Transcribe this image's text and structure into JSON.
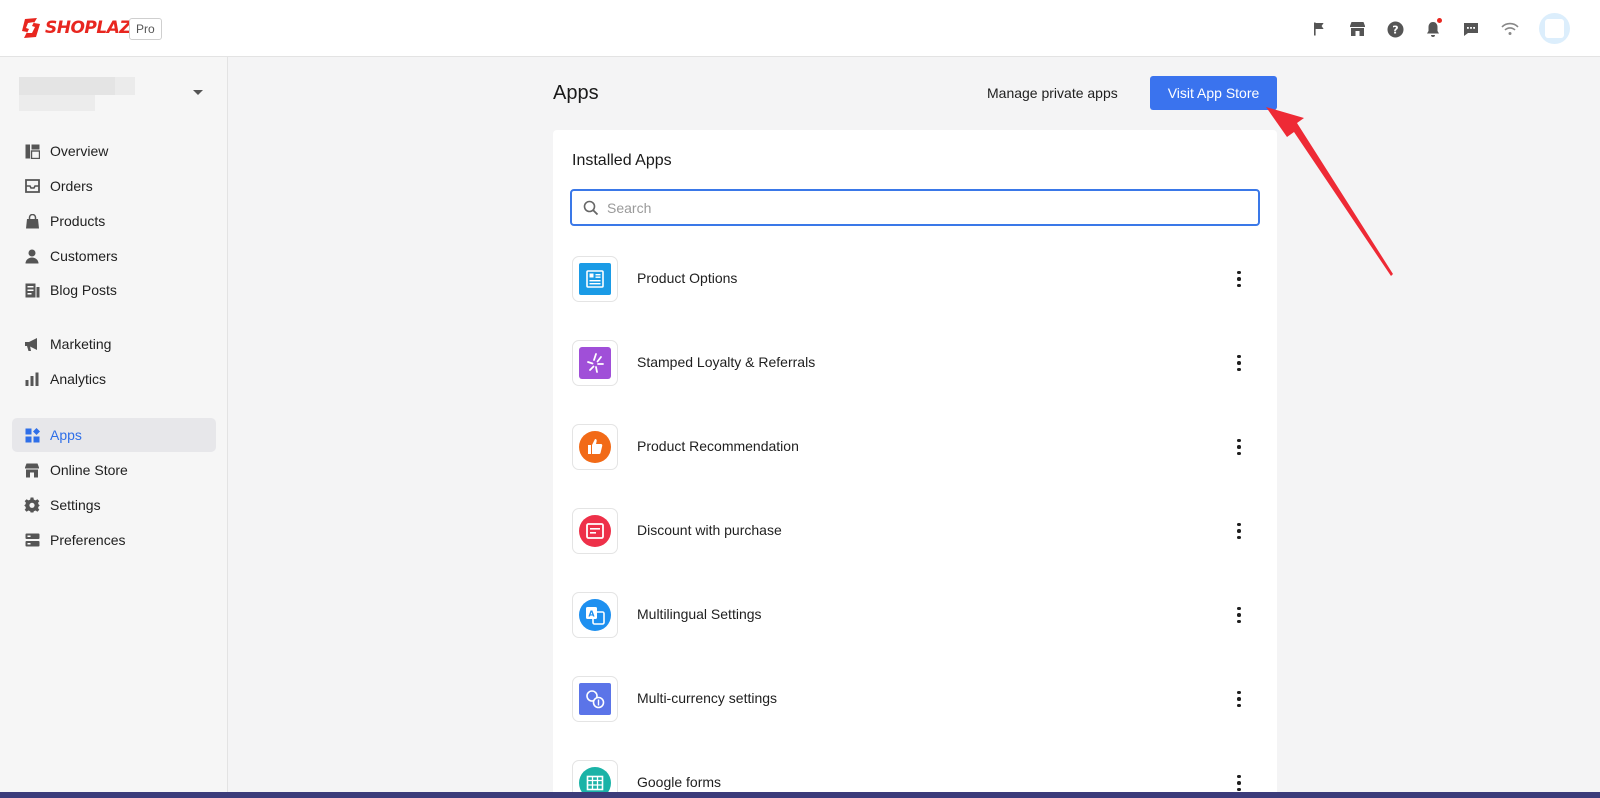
{
  "brand": {
    "name": "SHOPLAZZA",
    "plan": "Pro"
  },
  "topbar": {
    "icons": [
      "flag-icon",
      "storefront-icon",
      "help-icon",
      "bell-icon",
      "chat-icon",
      "wifi-icon"
    ]
  },
  "sidebar": {
    "items": [
      {
        "label": "Overview",
        "icon": "overview-icon",
        "active": false
      },
      {
        "label": "Orders",
        "icon": "orders-icon",
        "active": false
      },
      {
        "label": "Products",
        "icon": "products-icon",
        "active": false
      },
      {
        "label": "Customers",
        "icon": "customers-icon",
        "active": false
      },
      {
        "label": "Blog Posts",
        "icon": "blog-icon",
        "active": false
      },
      {
        "label": "Marketing",
        "icon": "megaphone-icon",
        "active": false
      },
      {
        "label": "Analytics",
        "icon": "analytics-icon",
        "active": false
      },
      {
        "label": "Apps",
        "icon": "apps-icon",
        "active": true
      },
      {
        "label": "Online Store",
        "icon": "storefront-icon",
        "active": false
      },
      {
        "label": "Settings",
        "icon": "gear-icon",
        "active": false
      },
      {
        "label": "Preferences",
        "icon": "preferences-icon",
        "active": false
      }
    ]
  },
  "main": {
    "title": "Apps",
    "manage_label": "Manage private apps",
    "visit_label": "Visit App Store",
    "card_title": "Installed Apps",
    "search": {
      "placeholder": "Search",
      "value": ""
    },
    "apps": [
      {
        "name": "Product Options",
        "icon": "product-options-icon",
        "color": "#1a9be6"
      },
      {
        "name": "Stamped Loyalty & Referrals",
        "icon": "sparkle-icon",
        "color": "#a04fd8"
      },
      {
        "name": "Product Recommendation",
        "icon": "thumbs-up-icon",
        "color": "#f26a17"
      },
      {
        "name": "Discount with purchase",
        "icon": "discount-icon",
        "color": "#ee3049"
      },
      {
        "name": "Multilingual Settings",
        "icon": "translate-icon",
        "color": "#1e90f0"
      },
      {
        "name": "Multi-currency settings",
        "icon": "currency-icon",
        "color": "#5b74e8"
      },
      {
        "name": "Google forms",
        "icon": "table-icon",
        "color": "#1bb3a7"
      }
    ]
  },
  "colors": {
    "accent": "#3a73ee",
    "active_text": "#2f6fe8",
    "annotation": "#ee2a35"
  }
}
